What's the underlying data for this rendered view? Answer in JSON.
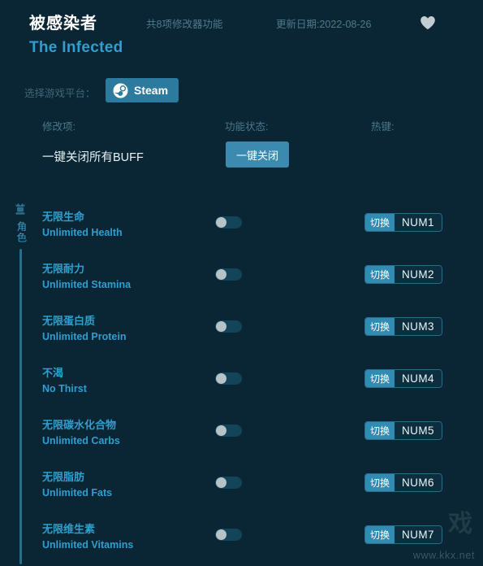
{
  "header": {
    "title_cn": "被感染者",
    "title_en": "The Infected",
    "feature_count": "共8项修改器功能",
    "update_date": "更新日期:2022-08-26",
    "favorite_icon": "heart-icon"
  },
  "platform": {
    "label": "选择游戏平台：",
    "selected": "Steam",
    "icon": "steam-icon"
  },
  "columns": {
    "modifier": "修改项:",
    "status": "功能状态:",
    "hotkey": "热键:"
  },
  "master": {
    "label": "一键关闭所有BUFF",
    "button": "一键关闭"
  },
  "category": {
    "name": "角色",
    "icon": "character-icon"
  },
  "rows": [
    {
      "cn": "无限生命",
      "en": "Unlimited Health",
      "state": "off",
      "hotkey_action": "切换",
      "hotkey_key": "NUM1"
    },
    {
      "cn": "无限耐力",
      "en": "Unlimited Stamina",
      "state": "off",
      "hotkey_action": "切换",
      "hotkey_key": "NUM2"
    },
    {
      "cn": "无限蛋白质",
      "en": "Unlimited Protein",
      "state": "off",
      "hotkey_action": "切换",
      "hotkey_key": "NUM3"
    },
    {
      "cn": "不渴",
      "en": "No Thirst",
      "state": "off",
      "hotkey_action": "切换",
      "hotkey_key": "NUM4"
    },
    {
      "cn": "无限碳水化合物",
      "en": "Unlimited Carbs",
      "state": "off",
      "hotkey_action": "切换",
      "hotkey_key": "NUM5"
    },
    {
      "cn": "无限脂肪",
      "en": "Unlimited Fats",
      "state": "off",
      "hotkey_action": "切换",
      "hotkey_key": "NUM6"
    },
    {
      "cn": "无限维生素",
      "en": "Unlimited Vitamins",
      "state": "off",
      "hotkey_action": "切换",
      "hotkey_key": "NUM7"
    }
  ],
  "watermark": {
    "logo": "戏",
    "url": "www.kkx.net"
  },
  "colors": {
    "background": "#0a2533",
    "accent_cyan": "#2f9fd0",
    "button_blue": "#3d8ab0",
    "steam_blue": "#2c7b9e",
    "muted_text": "#4e7b8c",
    "white_text": "#ffffff"
  }
}
